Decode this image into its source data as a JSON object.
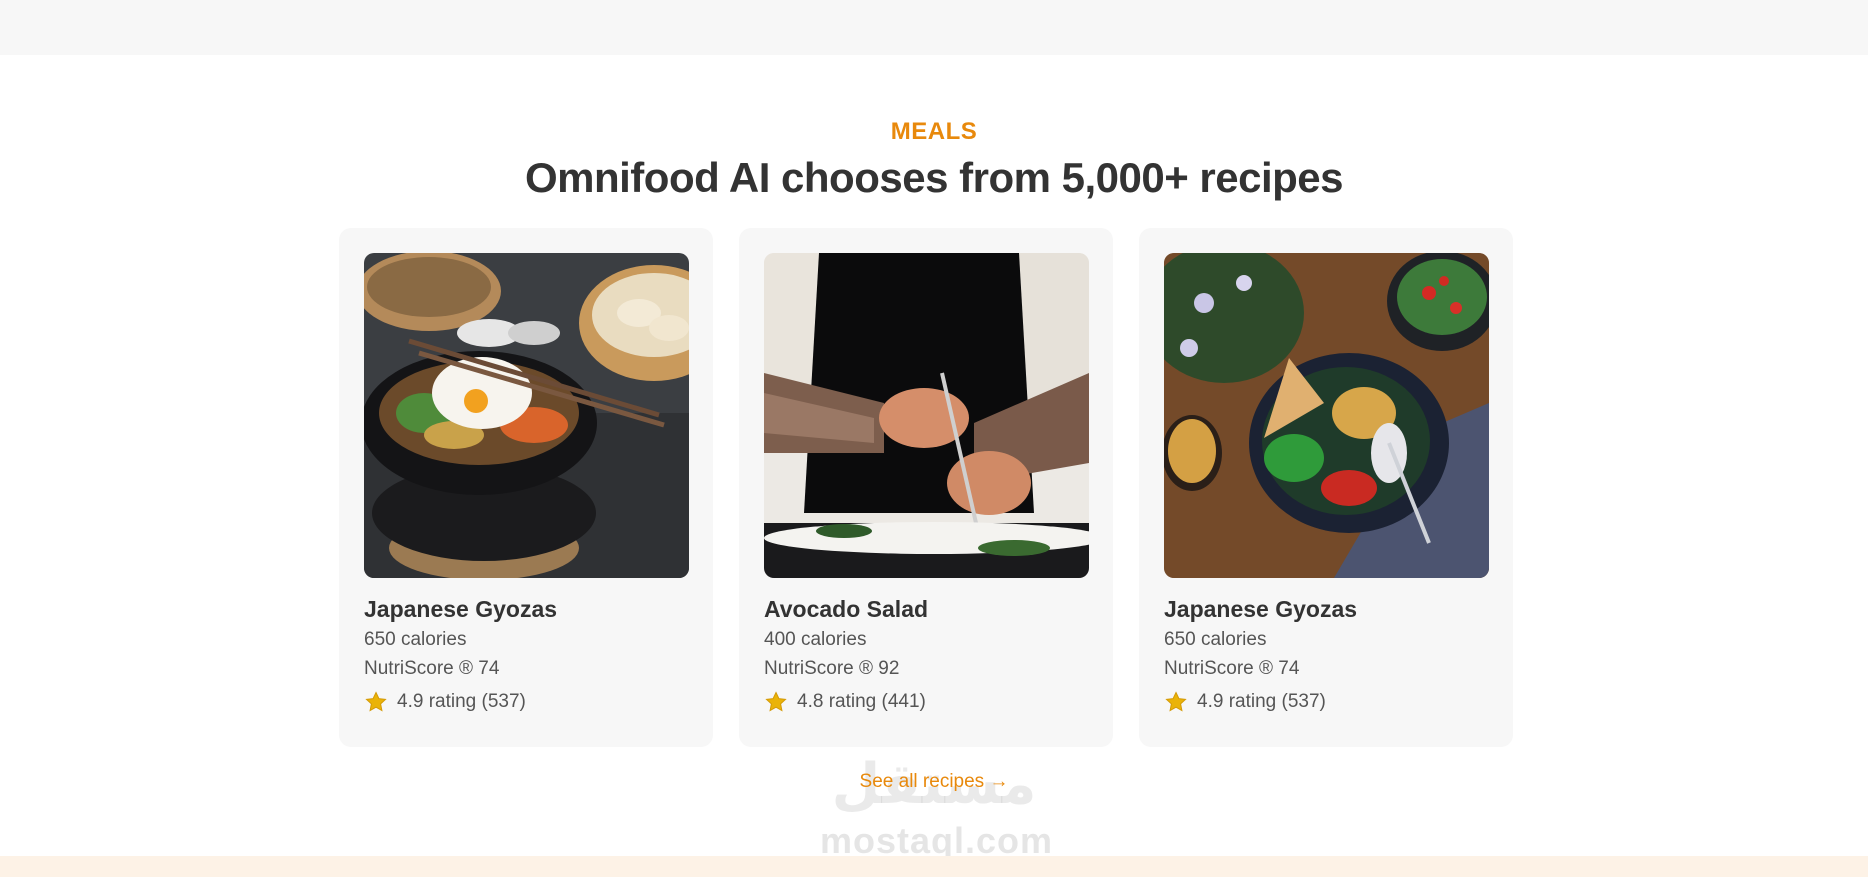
{
  "section": {
    "eyebrow": "MEALS",
    "heading": "Omnifood AI chooses from 5,000+ recipes"
  },
  "meals": [
    {
      "title": "Japanese Gyozas",
      "calories": "650 calories",
      "nutriscore": "NutriScore ® 74",
      "rating": "4.9 rating (537)"
    },
    {
      "title": "Avocado Salad",
      "calories": "400 calories",
      "nutriscore": "NutriScore ® 92",
      "rating": "4.8 rating (441)"
    },
    {
      "title": "Japanese Gyozas",
      "calories": "650 calories",
      "nutriscore": "NutriScore ® 74",
      "rating": "4.9 rating (537)"
    }
  ],
  "see_all": "See all recipes →",
  "watermark": {
    "latin": "mostaql.com",
    "arabic": "مستقل"
  },
  "icons": {
    "rating": "star-icon"
  },
  "colors": {
    "accent": "#e8890c",
    "star": "#eab308",
    "card_bg": "#f7f7f7",
    "text": "#333333"
  }
}
